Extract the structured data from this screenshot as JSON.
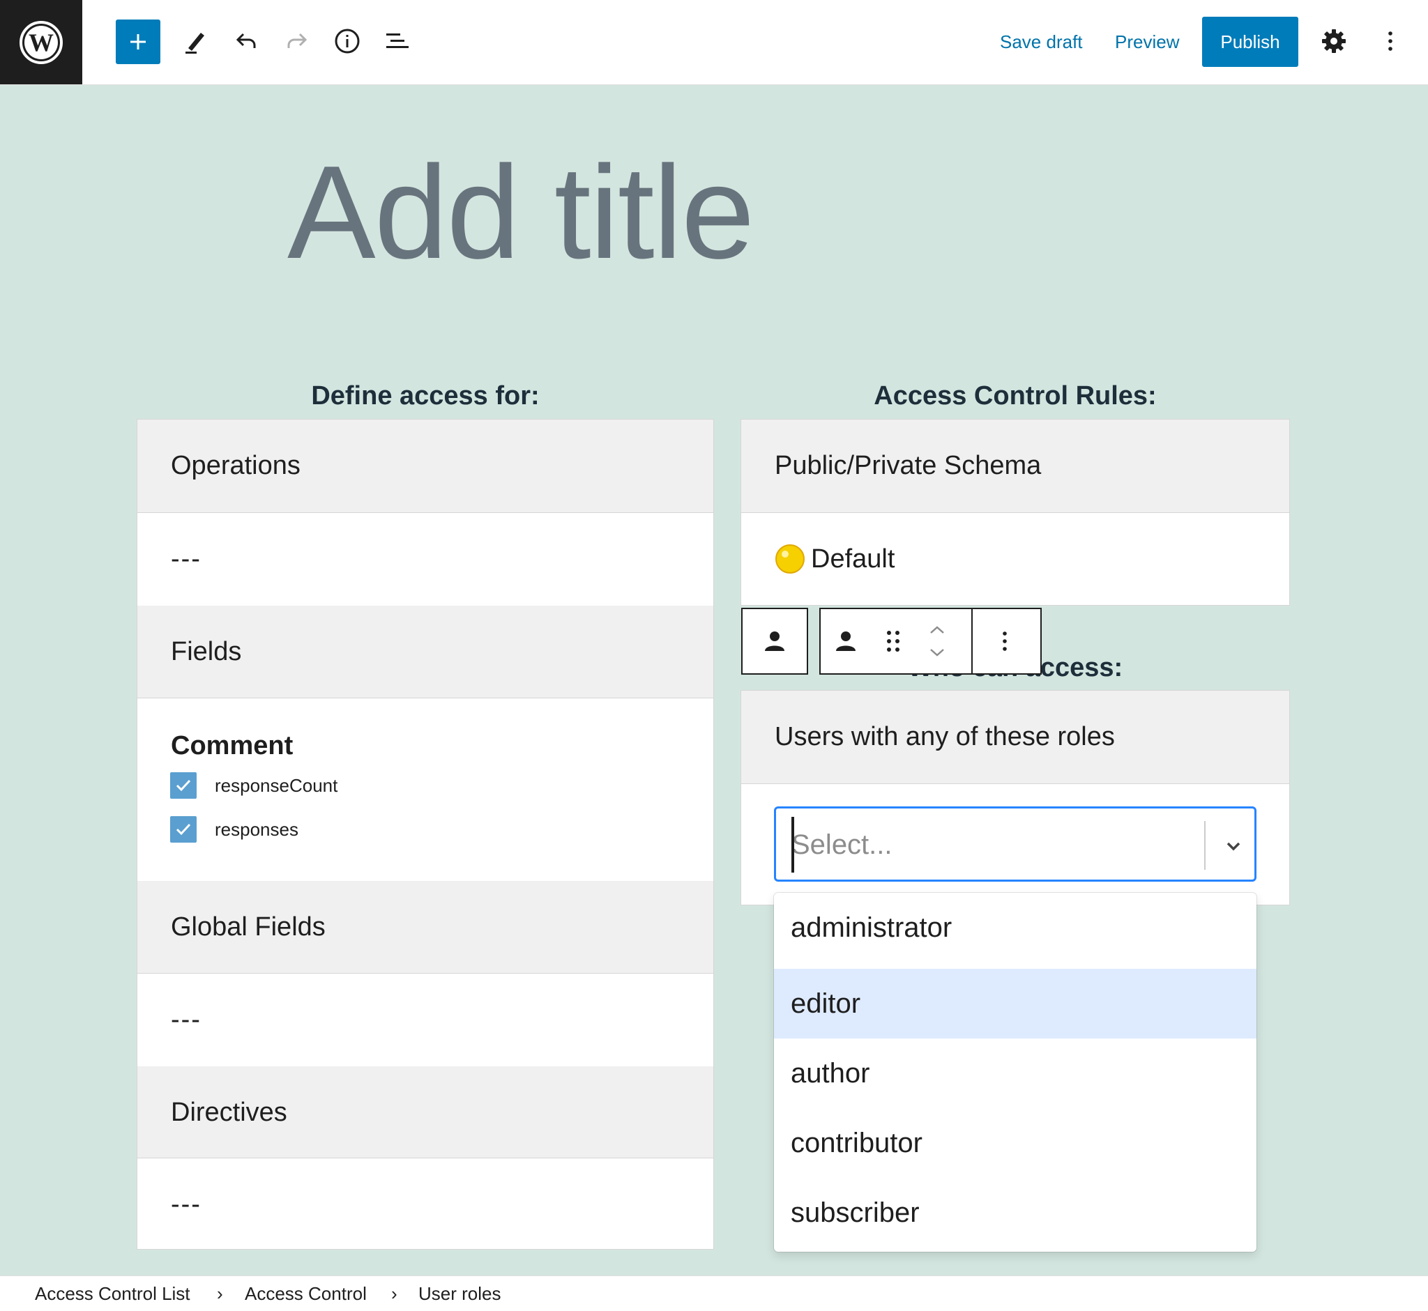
{
  "header": {
    "save_draft": "Save draft",
    "preview": "Preview",
    "publish": "Publish",
    "icons": [
      "wordpress-logo",
      "plus-icon",
      "pencil-icon",
      "undo-icon",
      "redo-icon",
      "info-icon",
      "list-view-icon",
      "gear-icon",
      "kebab-icon"
    ]
  },
  "editor": {
    "title_placeholder": "Add title"
  },
  "left": {
    "heading": "Define access for:",
    "operations": {
      "label": "Operations",
      "value": "---"
    },
    "fields": {
      "label": "Fields",
      "group": "Comment",
      "items": [
        {
          "label": "responseCount",
          "checked": true
        },
        {
          "label": "responses",
          "checked": true
        }
      ]
    },
    "global_fields": {
      "label": "Global Fields",
      "value": "---"
    },
    "directives": {
      "label": "Directives",
      "value": "---"
    }
  },
  "right": {
    "heading": "Access Control Rules:",
    "schema": {
      "label": "Public/Private Schema",
      "value": "Default",
      "indicator_color": "#f6d000"
    },
    "who_heading": "Who can access:",
    "roles_panel": {
      "label": "Users with any of these roles",
      "placeholder": "Select...",
      "options": [
        "administrator",
        "editor",
        "author",
        "contributor",
        "subscriber"
      ],
      "highlighted": "editor"
    }
  },
  "breadcrumb": [
    "Access Control List",
    "Access Control",
    "User roles"
  ],
  "colors": {
    "accent": "#007cba",
    "canvas": "#d3e5df",
    "focus": "#2684ff",
    "option_focus": "#deebff"
  }
}
